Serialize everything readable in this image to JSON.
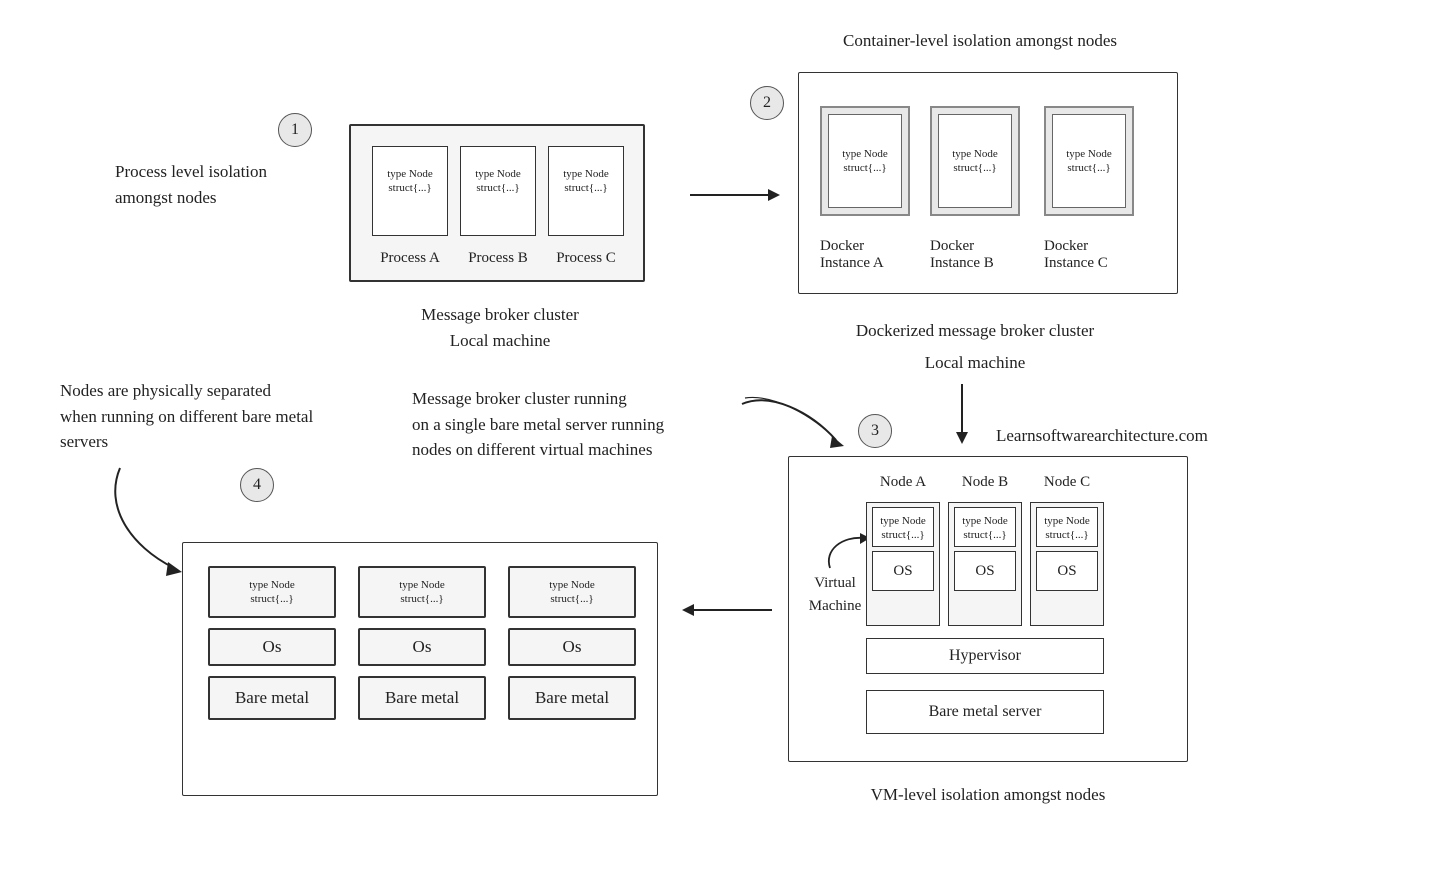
{
  "step1": {
    "num": "1",
    "title": "Process level isolation\namongst nodes",
    "node_text": "type Node\nstruct{...}",
    "proc_a": "Process A",
    "proc_b": "Process B",
    "proc_c": "Process C",
    "caption1": "Message broker cluster",
    "caption2": "Local machine"
  },
  "step2": {
    "num": "2",
    "title": "Container-level isolation amongst nodes",
    "node_text": "type Node\nstruct{...}",
    "docker_a": "Docker\nInstance A",
    "docker_b": "Docker\nInstance B",
    "docker_c": "Docker\nInstance C",
    "caption1": "Dockerized message broker cluster",
    "caption2": "Local machine"
  },
  "step3": {
    "num": "3",
    "watermark": "Learnsoftwarearchitecture.com",
    "desc": "Message broker cluster running\non a single bare metal server running\nnodes on different virtual machines",
    "vm_label": "Virtual\nMachine",
    "node_a": "Node A",
    "node_b": "Node B",
    "node_c": "Node C",
    "node_text": "type Node\nstruct{...}",
    "os": "OS",
    "hypervisor": "Hypervisor",
    "bare_metal": "Bare metal server",
    "caption": "VM-level isolation amongst nodes"
  },
  "step4": {
    "num": "4",
    "title": "Nodes are physically separated\nwhen running on different bare metal\nservers",
    "node_text": "type Node\nstruct{...}",
    "os": "Os",
    "bare_metal": "Bare metal"
  }
}
